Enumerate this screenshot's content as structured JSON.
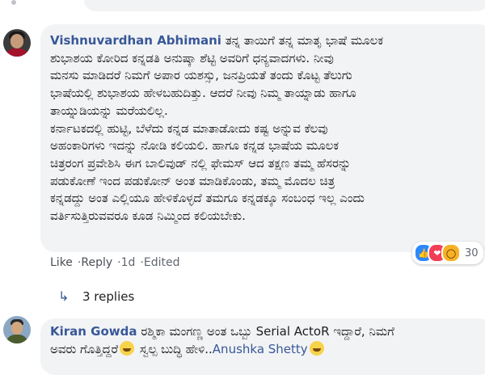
{
  "comments": [
    {
      "author": "Vishnuvardhan Abhimani",
      "lines": [
        "ತನ್ನ ತಾಯಿಗೆ ತನ್ನ ಮಾತೃ ಭಾಷೆ ಮೂಲಕ",
        "ಶುಭಾಶಯ ಕೋರಿದ ಕನ್ನಡತಿ ಅನುಷ್ಕಾ ಶೆಟ್ಟಿ ಅವರಿಗೆ ಧನ್ಯವಾದಗಳು. ನೀವು",
        "ಮನಸು ಮಾಡಿದರೆ ನಿಮಗೆ ಅಪಾರ ಯಶಸ್ಸು, ಜನಪ್ರಿಯತೆ ತಂದು ಕೊಟ್ಟ ತೆಲುಗು",
        "ಭಾಷೆಯಲ್ಲಿ ಶುಭಾಶಯ ಹೇಳಬಹುದಿತ್ತು. ಆದರೆ ನೀವು ನಿಮ್ಮ ತಾಯ್ನಾಡು ಹಾಗೂ",
        "ತಾಯ್ನುಡಿಯನ್ನು ಮರೆಯಲಿಲ್ಲ.",
        "ಕರ್ನಾಟಕದಲ್ಲಿ ಹುಟ್ಟಿ, ಬೆಳೆದು ಕನ್ನಡ ಮಾತಾಡೋದು ಕಷ್ಟ ಅನ್ನುವ ಕೆಲವು",
        "ಅಹಂಕಾರಿಗಳು ಇದನ್ನು ನೋಡಿ ಕಲಿಯಲಿ. ಹಾಗೂ ಕನ್ನಡ ಭಾಷೆಯ ಮೂಲಕ",
        "ಚಿತ್ರರಂಗ ಪ್ರವೇಶಿಸಿ ಈಗ ಬಾಲಿವುಡ್ ನಲ್ಲಿ ಫೇಮಸ್ ಆದ ತಕ್ಷಣ ತಮ್ಮ ಹೆಸರನ್ನು",
        "ಪಡುಕೋಣೆ ಇಂದ ಪಡುಕೋನ್ ಅಂತ ಮಾಡಿಕೊಂಡು, ತಮ್ಮ ಮೊದಲ ಚಿತ್ರ",
        "ಕನ್ನಡದ್ದು ಅಂತ ಎಲ್ಲಿಯೂ ಹೇಳಿಕೊಳ್ಳದೆ ತಮಗೂ ಕನ್ನಡಕ್ಕೂ ಸಂಬಂಧ ಇಲ್ಲ ಎಂದು",
        "ವರ್ತಿಸುತ್ತಿರುವವರೂ ಕೂಡ ನಿಮ್ಮಿಂದ ಕಲಿಯಬೇಕು."
      ],
      "actions": {
        "like": "Like",
        "reply": "Reply",
        "time": "1d",
        "edited": "Edited"
      },
      "reactions": {
        "icons": [
          "like-icon",
          "love-icon",
          "wow-icon"
        ],
        "count": "30"
      },
      "replies_label": "3 replies"
    },
    {
      "author": "Kiran Gowda",
      "line1": "ರಶ್ಮಿಕಾ ಮಂಗಣ್ಣ ಅಂತ ಒಬ್ಬು Serial ActoR ಇದ್ದಾರೆ, ನಿಮಗೆ",
      "line2_a": "ಅವರು ಗೊತ್ತಿದ್ದರೆ",
      "line2_b": "ಸ್ವಲ್ಪ ಬುದ್ಧಿ ಹೇಳಿ..",
      "mention": "Anushka Shetty"
    }
  ],
  "colors": {
    "link": "#385898",
    "bubble": "#f2f3f5",
    "meta": "#606770"
  }
}
